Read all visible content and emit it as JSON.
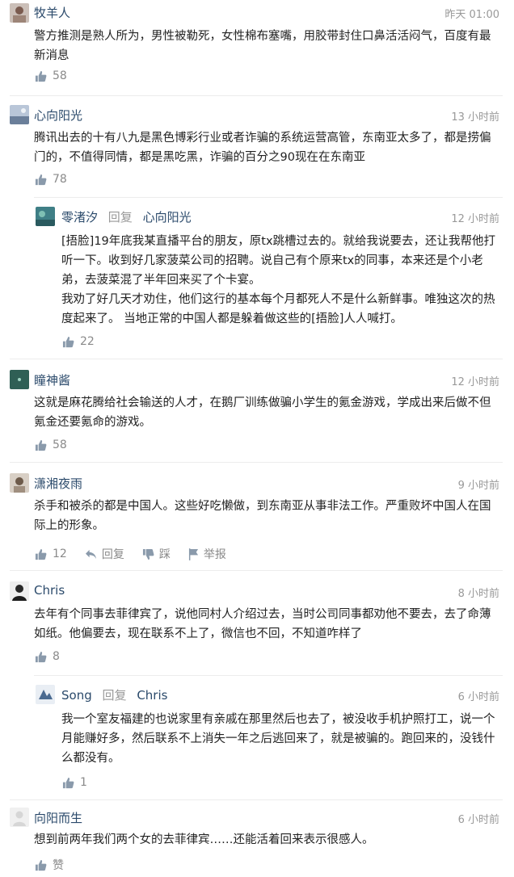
{
  "comments": [
    {
      "name": "牧羊人",
      "time": "昨天 01:00",
      "text": "警方推测是熟人所为，男性被勒死，女性棉布塞嘴，用胶带封住口鼻活活闷气，百度有最新消息",
      "likes": "58"
    },
    {
      "name": "心向阳光",
      "time": "13 小时前",
      "text": "腾讯出去的十有八九是黑色博彩行业或者诈骗的系统运营高管，东南亚太多了，都是捞偏门的，不值得同情，都是黑吃黑，诈骗的百分之90现在在东南亚",
      "likes": "78",
      "reply": {
        "name": "零渚汐",
        "reply_label": "回复",
        "target": "心向阳光",
        "time": "12 小时前",
        "text": "[捂脸]19年底我某直播平台的朋友，原tx跳槽过去的。就给我说要去，还让我帮他打听一下。收到好几家菠菜公司的招聘。说自己有个原来tx的同事，本来还是个小老弟，去菠菜混了半年回来买了个卡宴。\n我劝了好几天才劝住，他们这行的基本每个月都死人不是什么新鲜事。唯独这次的热度起来了。 当地正常的中国人都是躲着做这些的[捂脸]人人喊打。",
        "likes": "22"
      }
    },
    {
      "name": "瞳神酱",
      "time": "12 小时前",
      "text": "这就是麻花腾给社会输送的人才，在鹅厂训练做骗小学生的氪金游戏，学成出来后做不但氪金还要氪命的游戏。",
      "likes": "58"
    },
    {
      "name": "潇湘夜雨",
      "time": "9 小时前",
      "text": "杀手和被杀的都是中国人。这些好吃懒做，到东南亚从事非法工作。严重败坏中国人在国际上的形象。",
      "likes": "12",
      "actions": {
        "reply": "回复",
        "dislike": "踩",
        "report": "举报"
      }
    },
    {
      "name": "Chris",
      "time": "8 小时前",
      "text": "去年有个同事去菲律宾了，说他同村人介绍过去，当时公司同事都劝他不要去，去了命薄如纸。他偏要去，现在联系不上了，微信也不回，不知道咋样了",
      "likes": "8",
      "reply": {
        "name": "Song",
        "reply_label": "回复",
        "target": "Chris",
        "time": "6 小时前",
        "text": "我一个室友福建的也说家里有亲戚在那里然后也去了，被没收手机护照打工，说一个月能赚好多，然后联系不上消失一年之后逃回来了，就是被骗的。跑回来的，没钱什么都没有。",
        "likes": "1"
      }
    },
    {
      "name": "向阳而生",
      "time": "6 小时前",
      "text": "想到前两年我们两个女的去菲律宾……还能活着回来表示很感人。",
      "likes": "赞"
    }
  ]
}
